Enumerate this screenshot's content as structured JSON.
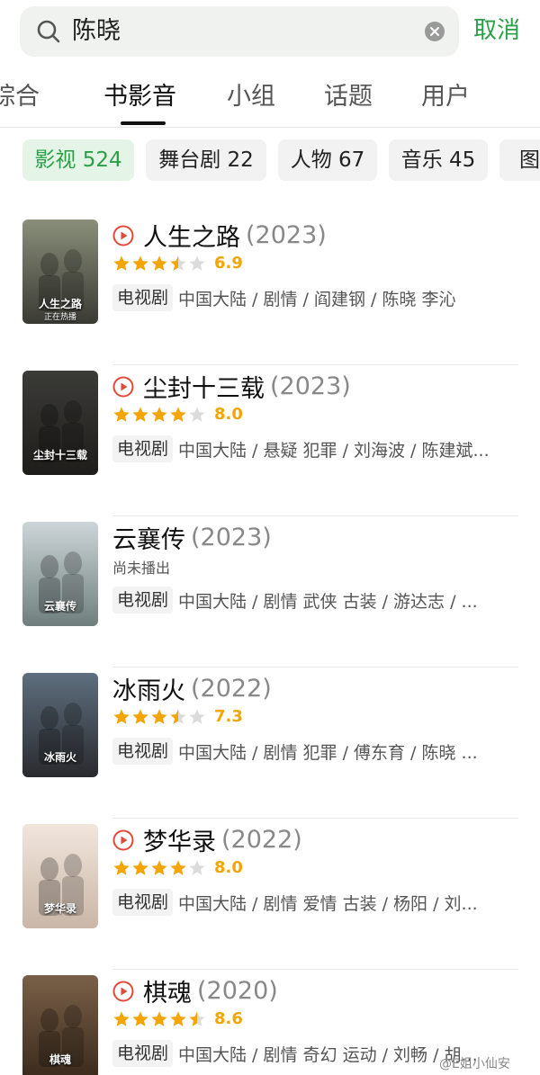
{
  "search": {
    "query": "陈晓",
    "cancel_label": "取消"
  },
  "tabs": [
    {
      "label": "综合",
      "active": false
    },
    {
      "label": "书影音",
      "active": true
    },
    {
      "label": "小组",
      "active": false
    },
    {
      "label": "话题",
      "active": false
    },
    {
      "label": "用户",
      "active": false
    }
  ],
  "chips": [
    {
      "label": "影视 524",
      "active": true
    },
    {
      "label": "舞台剧 22",
      "active": false
    },
    {
      "label": "人物 67",
      "active": false
    },
    {
      "label": "音乐 45",
      "active": false
    },
    {
      "label": "图书",
      "active": false
    }
  ],
  "results": [
    {
      "title": "人生之路",
      "year": "(2023)",
      "playable": true,
      "rating_stars": 3.5,
      "score": "6.9",
      "status": "",
      "type": "电视剧",
      "meta": "中国大陆 / 剧情 / 阎建钢 / 陈晓 李沁"
    },
    {
      "title": "尘封十三载",
      "year": "(2023)",
      "playable": true,
      "rating_stars": 4,
      "score": "8.0",
      "status": "",
      "type": "电视剧",
      "meta": "中国大陆 / 悬疑 犯罪 / 刘海波 / 陈建斌..."
    },
    {
      "title": "云襄传",
      "year": "(2023)",
      "playable": false,
      "rating_stars": null,
      "score": "",
      "status": "尚未播出",
      "type": "电视剧",
      "meta": "中国大陆 / 剧情 武侠 古装 / 游达志 / ..."
    },
    {
      "title": "冰雨火",
      "year": "(2022)",
      "playable": false,
      "rating_stars": 3.5,
      "score": "7.3",
      "status": "",
      "type": "电视剧",
      "meta": "中国大陆 / 剧情 犯罪 / 傅东育 / 陈晓 ..."
    },
    {
      "title": "梦华录",
      "year": "(2022)",
      "playable": true,
      "rating_stars": 4,
      "score": "8.0",
      "status": "",
      "type": "电视剧",
      "meta": "中国大陆 / 剧情 爱情 古装 / 杨阳 / 刘..."
    },
    {
      "title": "棋魂",
      "year": "(2020)",
      "playable": true,
      "rating_stars": 4.5,
      "score": "8.6",
      "status": "",
      "type": "电视剧",
      "meta": "中国大陆 / 剧情 奇幻 运动 / 刘畅 / 胡..."
    }
  ],
  "posters": [
    {
      "text1": "人生之路",
      "text2": "正在热播",
      "bg_top": "#8a8f7a",
      "bg_bottom": "#3a3a34"
    },
    {
      "text1": "尘封十三载",
      "text2": "",
      "bg_top": "#3b3b38",
      "bg_bottom": "#1f1d1a"
    },
    {
      "text1": "云襄传",
      "text2": "",
      "bg_top": "#cdd5d8",
      "bg_bottom": "#6f7f7d"
    },
    {
      "text1": "冰雨火",
      "text2": "",
      "bg_top": "#5e6f7e",
      "bg_bottom": "#2a2a2e"
    },
    {
      "text1": "梦华录",
      "text2": "",
      "bg_top": "#f1e6dc",
      "bg_bottom": "#c9b6a7"
    },
    {
      "text1": "棋魂",
      "text2": "",
      "bg_top": "#7a6048",
      "bg_bottom": "#3a2a1c"
    }
  ],
  "watermark": "@E姐小仙安",
  "colors": {
    "accent": "#2aa046",
    "star": "#f5a500",
    "star_empty": "#dcdcdc",
    "play": "#e24a3a"
  }
}
